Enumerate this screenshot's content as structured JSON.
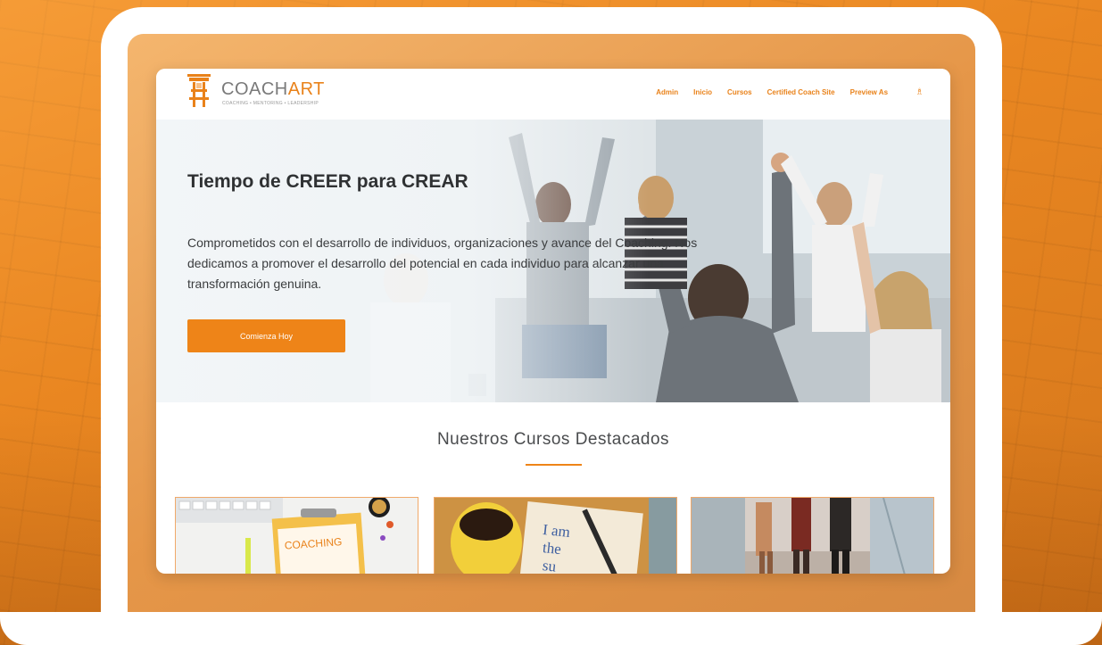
{
  "brand": {
    "name_part1": "COACH",
    "name_part2": "ART",
    "tagline": "COACHING • MENTORING • LEADERSHIP"
  },
  "nav": {
    "items": [
      "Admin",
      "Inicio",
      "Cursos",
      "Certified Coach Site",
      "Preview As"
    ],
    "cart_icon": "person-icon"
  },
  "hero": {
    "title": "Tiempo de CREER para CREAR",
    "text": "Comprometidos con el desarrollo de individuos, organizaciones y avance del Coaching. Nos dedicamos a promover el desarrollo del potencial en cada individuo para alcanzar una transformación genuina.",
    "button_label": "Comienza Hoy"
  },
  "featured": {
    "title": "Nuestros Cursos Destacados",
    "cards": [
      {
        "label": "COACHING"
      },
      {
        "label_line1": "I am",
        "label_line2": "the",
        "label_line3": "su"
      },
      {}
    ]
  },
  "colors": {
    "accent": "#ee8418",
    "background": "#ea8a24"
  }
}
